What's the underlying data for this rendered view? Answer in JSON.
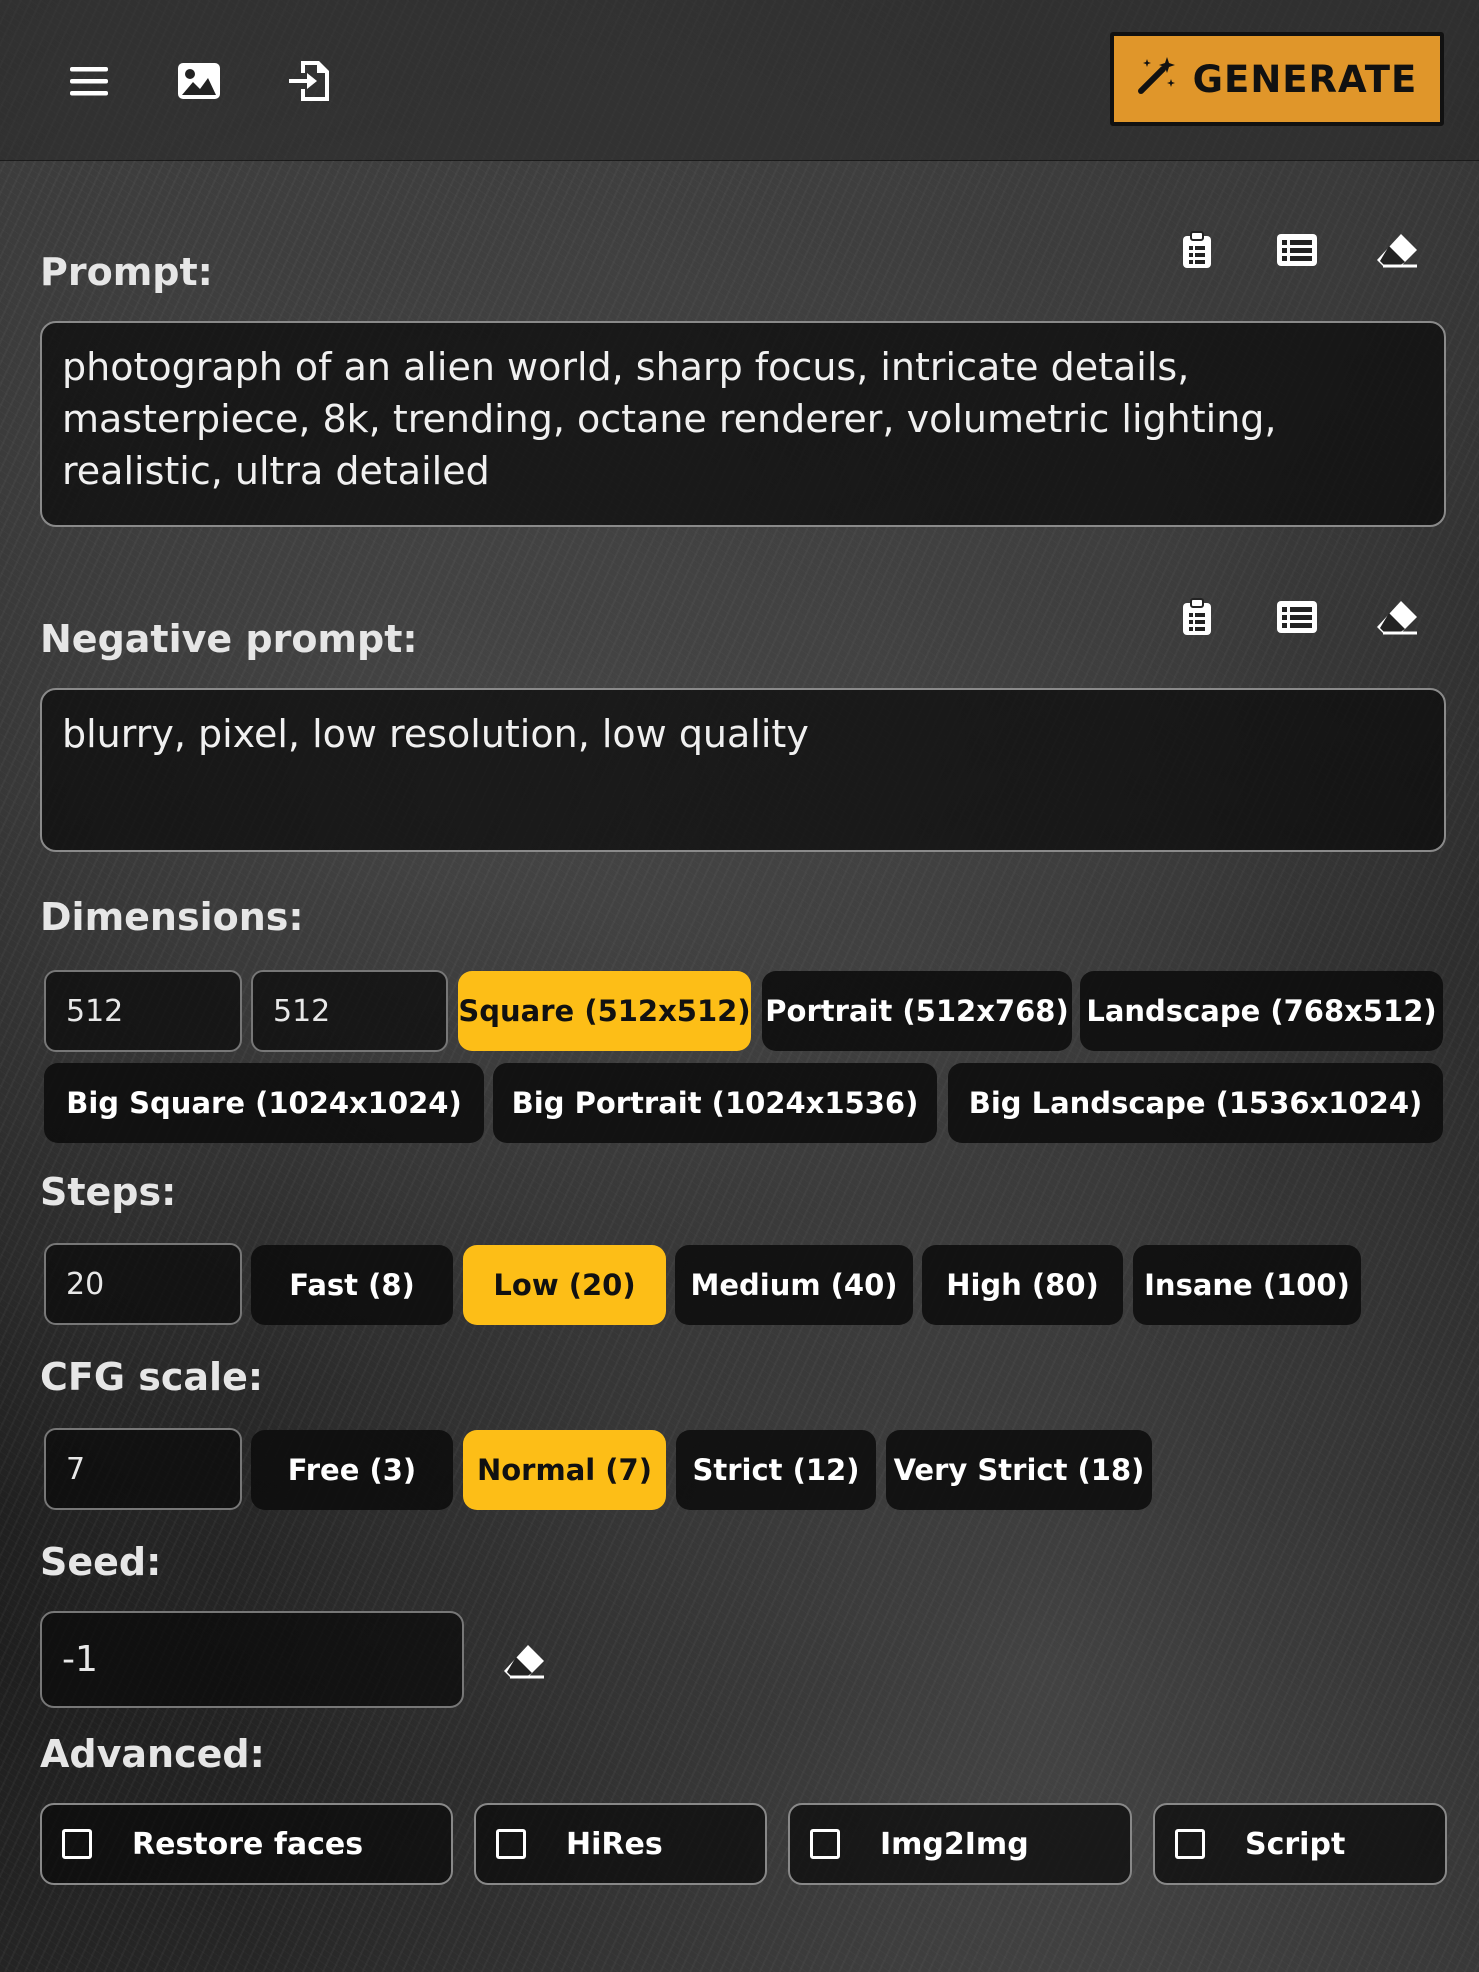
{
  "toolbar": {
    "menu_icon": "hamburger-menu-icon",
    "image_icon": "image-icon",
    "import_icon": "file-import-icon",
    "generate_label": "GENERATE",
    "generate_icon": "magic-wand-icon",
    "generate_color": "#e0962a"
  },
  "prompt": {
    "label": "Prompt:",
    "value": "photograph of an alien world, sharp focus, intricate details, masterpiece, 8k, trending, octane renderer, volumetric lighting, realistic, ultra detailed",
    "actions": [
      "clipboard-icon",
      "list-icon",
      "eraser-icon"
    ]
  },
  "negative_prompt": {
    "label": "Negative prompt:",
    "value": "blurry, pixel, low resolution, low quality",
    "actions": [
      "clipboard-icon",
      "list-icon",
      "eraser-icon"
    ]
  },
  "dimensions": {
    "label": "Dimensions:",
    "width": "512",
    "height": "512",
    "presets": [
      {
        "label": "Square (512x512)",
        "active": true
      },
      {
        "label": "Portrait (512x768)",
        "active": false
      },
      {
        "label": "Landscape (768x512)",
        "active": false
      },
      {
        "label": "Big Square (1024x1024)",
        "active": false
      },
      {
        "label": "Big Portrait (1024x1536)",
        "active": false
      },
      {
        "label": "Big Landscape (1536x1024)",
        "active": false
      }
    ]
  },
  "steps": {
    "label": "Steps:",
    "value": "20",
    "presets": [
      {
        "label": "Fast (8)",
        "active": false
      },
      {
        "label": "Low (20)",
        "active": true
      },
      {
        "label": "Medium (40)",
        "active": false
      },
      {
        "label": "High (80)",
        "active": false
      },
      {
        "label": "Insane (100)",
        "active": false
      }
    ]
  },
  "cfg": {
    "label": "CFG scale:",
    "value": "7",
    "presets": [
      {
        "label": "Free (3)",
        "active": false
      },
      {
        "label": "Normal (7)",
        "active": true
      },
      {
        "label": "Strict (12)",
        "active": false
      },
      {
        "label": "Very Strict (18)",
        "active": false
      }
    ]
  },
  "seed": {
    "label": "Seed:",
    "value": "-1",
    "clear_icon": "eraser-icon"
  },
  "advanced": {
    "label": "Advanced:",
    "options": [
      {
        "label": "Restore faces",
        "checked": false
      },
      {
        "label": "HiRes",
        "checked": false
      },
      {
        "label": "Img2Img",
        "checked": false
      },
      {
        "label": "Script",
        "checked": false
      }
    ]
  },
  "colors": {
    "accent": "#fdbe17",
    "generate": "#e0962a",
    "chip_bg": "#0c0c0c"
  }
}
